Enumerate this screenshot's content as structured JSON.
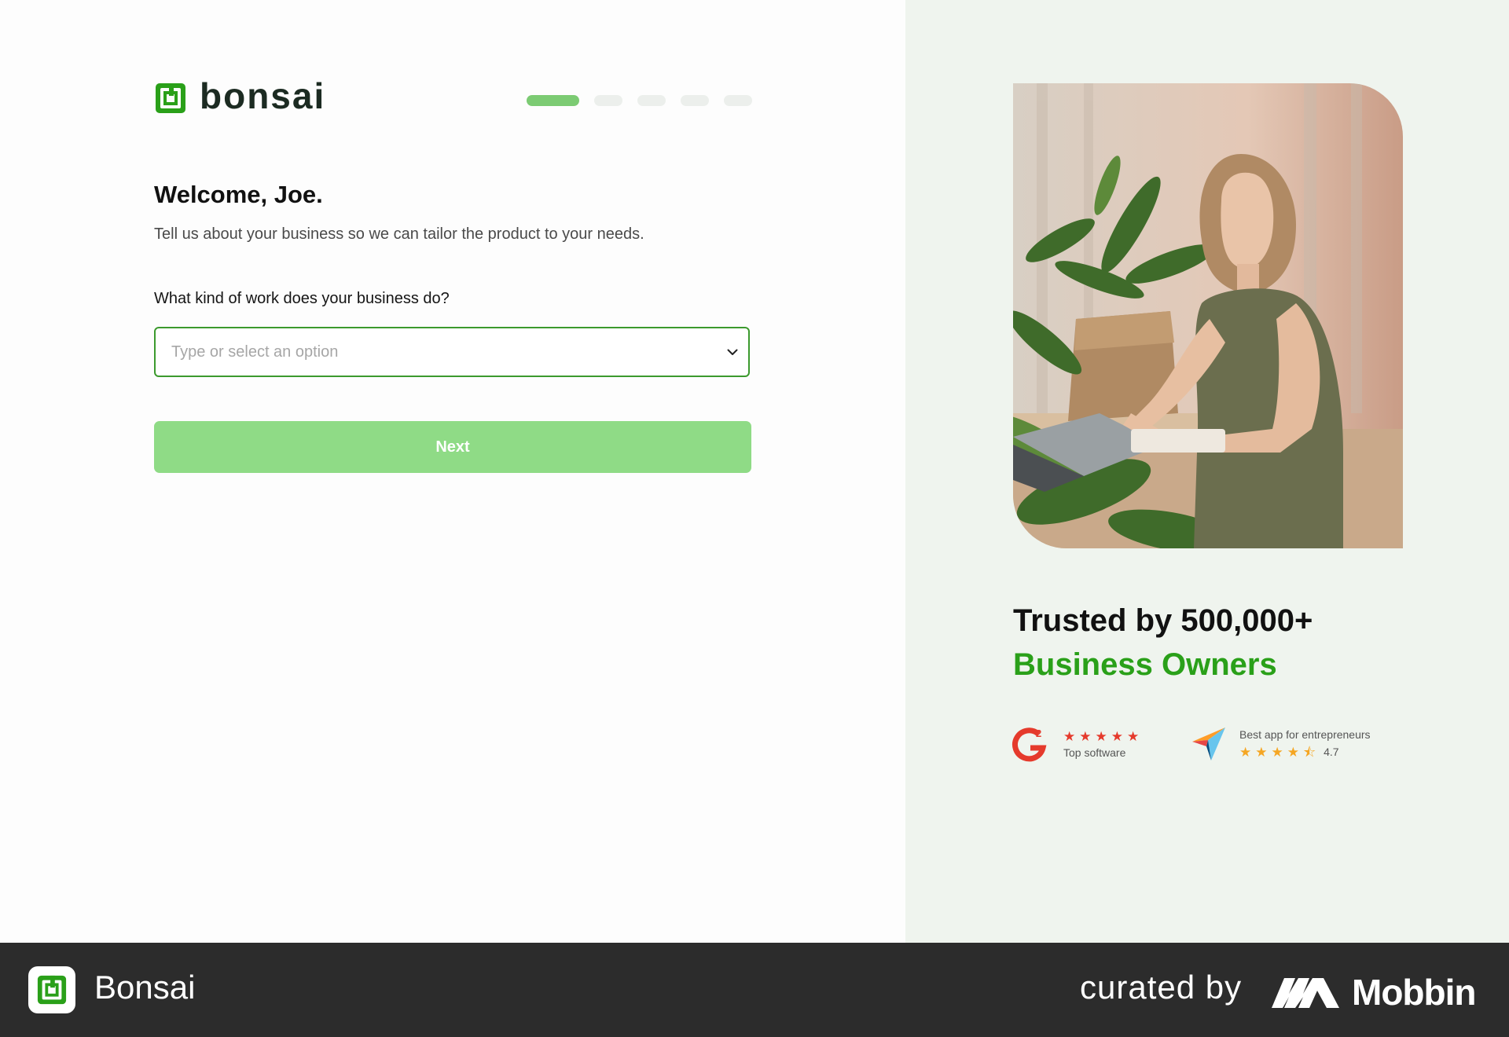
{
  "brand": {
    "name": "bonsai",
    "color": "#2aa019"
  },
  "progress": {
    "total_steps": 5,
    "current_step": 1
  },
  "onboarding": {
    "title": "Welcome, Joe.",
    "subtitle": "Tell us about your business so we can tailor the product to your needs.",
    "question": "What kind of work does your business do?",
    "select_placeholder": "Type or select an option",
    "select_value": "",
    "next_label": "Next"
  },
  "promo": {
    "photo_description_icon": "photo-woman-at-desk",
    "trusted_line1": "Trusted by 500,000+",
    "trusted_line2": "Business Owners",
    "g2": {
      "icon": "g2-logo-icon",
      "stars": 5,
      "label": "Top software",
      "star_color": "#e53a2c"
    },
    "capterra": {
      "icon": "capterra-logo-icon",
      "label": "Best app for entrepreneurs",
      "rating": 4.7,
      "rating_text": "4.7",
      "star_color": "#f5a623"
    }
  },
  "footer": {
    "app_name": "Bonsai",
    "curated_by": "curated by",
    "curator": "Mobbin"
  }
}
